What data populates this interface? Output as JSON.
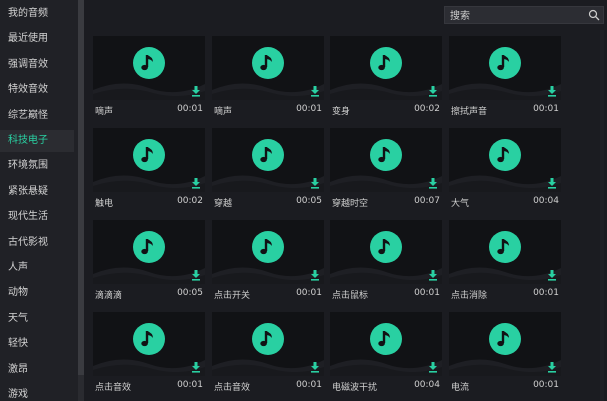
{
  "colors": {
    "accent": "#29d0a2",
    "background": "#1b1c21",
    "thumb": "#111215"
  },
  "sidebar": {
    "items": [
      {
        "label": "我的音频"
      },
      {
        "label": "最近使用"
      },
      {
        "label": "强调音效"
      },
      {
        "label": "特效音效"
      },
      {
        "label": "综艺巅怪"
      },
      {
        "label": "科技电子",
        "active": true
      },
      {
        "label": "环境氛围"
      },
      {
        "label": "紧张悬疑"
      },
      {
        "label": "现代生活"
      },
      {
        "label": "古代影视"
      },
      {
        "label": "人声"
      },
      {
        "label": "动物"
      },
      {
        "label": "天气"
      },
      {
        "label": "轻快"
      },
      {
        "label": "激昂"
      },
      {
        "label": "游戏"
      }
    ]
  },
  "search": {
    "placeholder": "搜索",
    "icon": "search-icon"
  },
  "sounds": [
    {
      "name": "嘀声",
      "duration": "00:01"
    },
    {
      "name": "嘀声",
      "duration": "00:01"
    },
    {
      "name": "变身",
      "duration": "00:02"
    },
    {
      "name": "擦拭声音",
      "duration": "00:01"
    },
    {
      "name": "触电",
      "duration": "00:02"
    },
    {
      "name": "穿越",
      "duration": "00:05"
    },
    {
      "name": "穿越时空",
      "duration": "00:07"
    },
    {
      "name": "大气",
      "duration": "00:04"
    },
    {
      "name": "滴滴滴",
      "duration": "00:05"
    },
    {
      "name": "点击开关",
      "duration": "00:01"
    },
    {
      "name": "点击鼠标",
      "duration": "00:01"
    },
    {
      "name": "点击消除",
      "duration": "00:01"
    },
    {
      "name": "点击音效",
      "duration": "00:01"
    },
    {
      "name": "点击音效",
      "duration": "00:01"
    },
    {
      "name": "电磁波干扰",
      "duration": "00:04"
    },
    {
      "name": "电流",
      "duration": "00:01"
    }
  ]
}
